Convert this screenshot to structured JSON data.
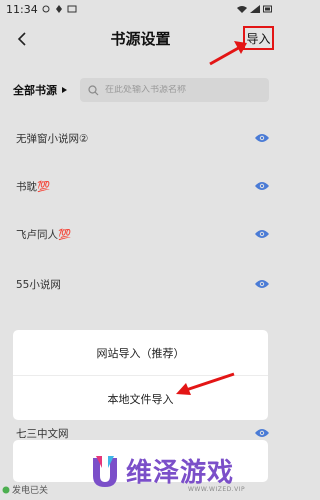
{
  "status_bar": {
    "time": "11:34"
  },
  "header": {
    "title": "书源设置",
    "import_label": "导入"
  },
  "filter": {
    "source_label": "全部书源",
    "search_placeholder": "在此处输入书源名称"
  },
  "sources": [
    {
      "name": "无弹窗小说网②"
    },
    {
      "name": "书耽💯"
    },
    {
      "name": "飞卢同人💯"
    },
    {
      "name": "55小说网"
    },
    {
      "name": "七三中文网"
    }
  ],
  "sheet": {
    "options": [
      "网站导入（推荐）",
      "本地文件导入"
    ]
  },
  "footer": {
    "fragment": "发电已关"
  },
  "watermark": {
    "text": "维泽游戏",
    "sub": "WWW.WIZED.VIP"
  },
  "colors": {
    "annotation_red": "#e31515",
    "eye_blue": "#4a7bd6",
    "watermark_purple": "#7b4fc9"
  }
}
